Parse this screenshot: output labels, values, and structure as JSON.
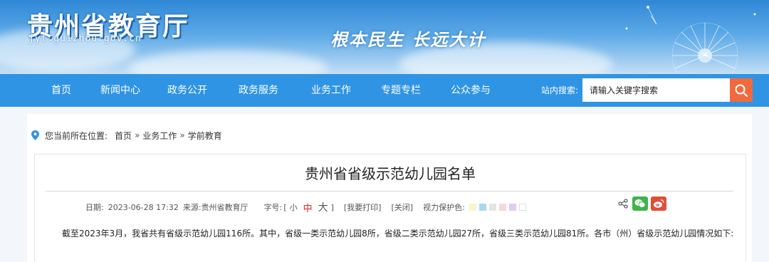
{
  "header": {
    "site_title": "贵州省教育厅",
    "site_domain": "jyt.guizhou.gov.cn",
    "slogan": "根本民生 长远大计"
  },
  "nav": {
    "items": [
      {
        "label": "首页"
      },
      {
        "label": "新闻中心"
      },
      {
        "label": "政务公开"
      },
      {
        "label": "政务服务"
      },
      {
        "label": "业务工作"
      },
      {
        "label": "专题专栏"
      },
      {
        "label": "公众参与"
      }
    ],
    "search_label": "站内搜索:",
    "search_placeholder": "请输入关键字搜索"
  },
  "breadcrumb": {
    "prefix": "您当前所在位置:",
    "items": [
      "首页",
      "业务工作",
      "学前教育"
    ],
    "separator": "»"
  },
  "article": {
    "title": "贵州省省级示范幼儿园名单",
    "date_label": "日期:",
    "date": "2023-06-28 17:32",
    "source_label": "来源:",
    "source": "贵州省教育厅",
    "font_label": "字号:",
    "font_open": "[",
    "font_small": "小",
    "font_mid": "中",
    "font_large": "大",
    "font_close": "]",
    "print_link": "[我要打印]",
    "close_link": "[关闭]",
    "eye_care_label": "视力保护色:",
    "eye_care_colors": [
      "#faf5c8",
      "#a8d8f2",
      "#e4e4e4",
      "#f8d6de",
      "#e3cbf0",
      "#ffffff"
    ],
    "body_first_line": "截至2023年3月，我省共有省级示范幼儿园116所。其中，省级一类示范幼儿园8所，省级二类示范幼儿园27所，省级三类示范幼儿园81所。各市（州）省级示范幼儿园情况如下:"
  },
  "colors": {
    "nav_bg": "#2f94e3",
    "search_button": "#f06a3e",
    "wechat": "#3fb44a",
    "weibo": "#e24c39",
    "font_active": "#d9261c"
  }
}
